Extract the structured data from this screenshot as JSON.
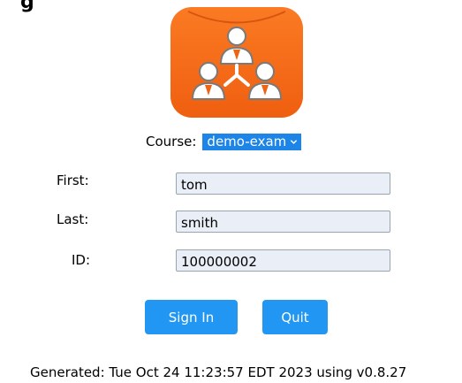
{
  "header": {
    "title_fragment": "g"
  },
  "logo": {
    "icon": "org-chart-people-icon",
    "accent": "#f26a17"
  },
  "course": {
    "label": "Course:",
    "selected": "demo-exam",
    "accent": "#1d84e8"
  },
  "form": {
    "first_label": "First:",
    "first_value": "tom",
    "last_label": "Last:",
    "last_value": "smith",
    "id_label": "ID:",
    "id_value": "100000002"
  },
  "actions": {
    "signin_label": "Sign In",
    "quit_label": "Quit",
    "button_color": "#2196f3"
  },
  "footer": {
    "text": "Generated: Tue Oct 24 11:23:57 EDT 2023 using v0.8.27"
  }
}
